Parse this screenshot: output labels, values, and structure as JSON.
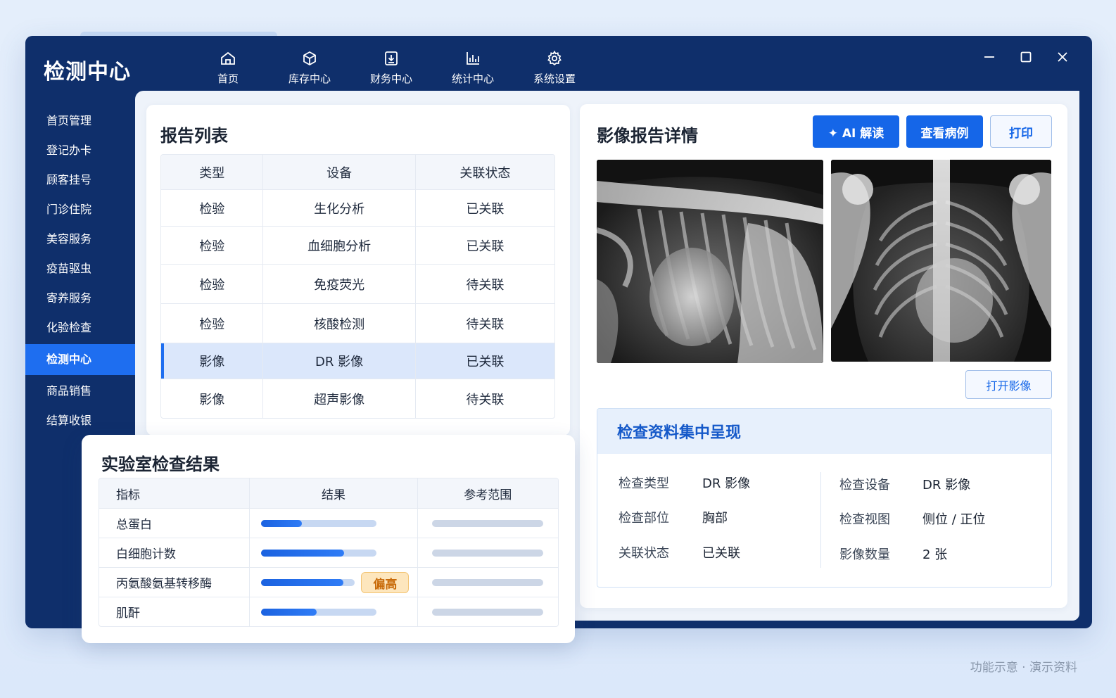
{
  "app": {
    "title": "检测中心"
  },
  "top_nav": [
    {
      "label": "首页",
      "icon": "home-icon"
    },
    {
      "label": "库存中心",
      "icon": "box-icon"
    },
    {
      "label": "财务中心",
      "icon": "finance-icon"
    },
    {
      "label": "统计中心",
      "icon": "chart-icon"
    },
    {
      "label": "系统设置",
      "icon": "gear-icon"
    }
  ],
  "sidebar": {
    "items": [
      {
        "label": "首页管理"
      },
      {
        "label": "登记办卡"
      },
      {
        "label": "顾客挂号"
      },
      {
        "label": "门诊住院"
      },
      {
        "label": "美容服务"
      },
      {
        "label": "疫苗驱虫"
      },
      {
        "label": "寄养服务"
      },
      {
        "label": "化验检查"
      },
      {
        "label": "检测中心",
        "active": true
      },
      {
        "label": "商品销售"
      },
      {
        "label": "结算收银"
      }
    ]
  },
  "report_list": {
    "title": "报告列表",
    "columns": [
      "类型",
      "设备",
      "关联状态"
    ],
    "rows": [
      [
        "检验",
        "生化分析",
        "已关联"
      ],
      [
        "检验",
        "血细胞分析",
        "已关联"
      ],
      [
        "检验",
        "免疫荧光",
        "待关联"
      ],
      [
        "检验",
        "核酸检测",
        "待关联"
      ],
      [
        "影像",
        "DR 影像",
        "已关联"
      ],
      [
        "影像",
        "超声影像",
        "待关联"
      ]
    ],
    "selected_index": 4
  },
  "lab_results": {
    "title": "实验室检查结果",
    "columns": [
      "指标",
      "结果",
      "参考范围"
    ],
    "rows": [
      {
        "name": "总蛋白",
        "level": 0.35
      },
      {
        "name": "白细胞计数",
        "level": 0.72
      },
      {
        "name": "丙氨酸氨基转移酶",
        "level": 0.88,
        "badge": "偏高"
      },
      {
        "name": "肌酐",
        "level": 0.48
      }
    ]
  },
  "image_detail": {
    "title": "影像报告详情",
    "buttons": {
      "ai": "✦ AI 解读",
      "case": "查看病例",
      "print": "打印"
    },
    "open_image": "打开影像",
    "info": {
      "heading": "检查资料集中呈现",
      "left": [
        {
          "label": "检查类型",
          "value": "DR 影像"
        },
        {
          "label": "检查部位",
          "value": "胸部"
        },
        {
          "label": "关联状态",
          "value": "已关联"
        }
      ],
      "right": [
        {
          "label": "检查设备",
          "value": "DR 影像"
        },
        {
          "label": "检查视图",
          "value": "侧位 / 正位"
        },
        {
          "label": "影像数量",
          "value": "2 张"
        }
      ]
    }
  },
  "footer": {
    "note": "功能示意 · 演示资料"
  },
  "colors": {
    "nav_bg": "#0f2f6b",
    "accent": "#1e6ef0",
    "warn": "#c86a08"
  }
}
